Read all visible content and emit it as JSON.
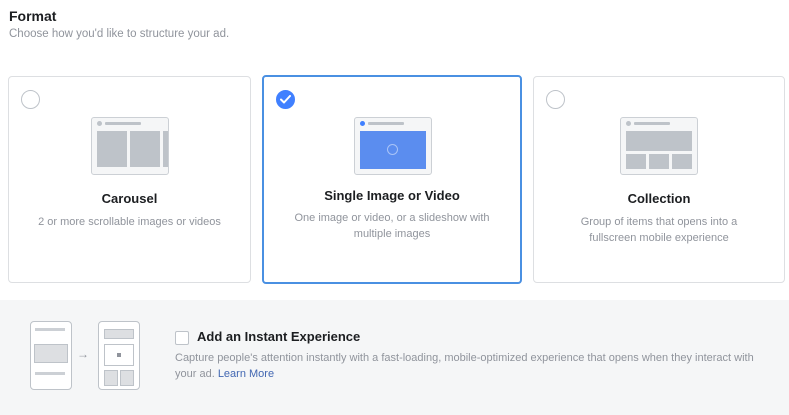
{
  "header": {
    "title": "Format",
    "subtitle": "Choose how you'd like to structure your ad."
  },
  "formats": [
    {
      "label": "Carousel",
      "description": "2 or more scrollable images or videos",
      "selected": false,
      "icon": "carousel-thumbnail-icon"
    },
    {
      "label": "Single Image or Video",
      "description": "One image or video, or a slideshow with multiple images",
      "selected": true,
      "icon": "single-image-thumbnail-icon"
    },
    {
      "label": "Collection",
      "description": "Group of items that opens into a fullscreen mobile experience",
      "selected": false,
      "icon": "collection-thumbnail-icon"
    }
  ],
  "instant_experience": {
    "label": "Add an Instant Experience",
    "checked": false,
    "description": "Capture people's attention instantly with a fast-loading, mobile-optimized experience that opens when they interact with your ad.",
    "link": "Learn More",
    "arrow": "→"
  },
  "colors": {
    "accent": "#4080ff",
    "selected_border": "#4a90e2",
    "link": "#4267b2",
    "muted_text": "#90949c",
    "panel_bg": "#f5f6f7"
  }
}
